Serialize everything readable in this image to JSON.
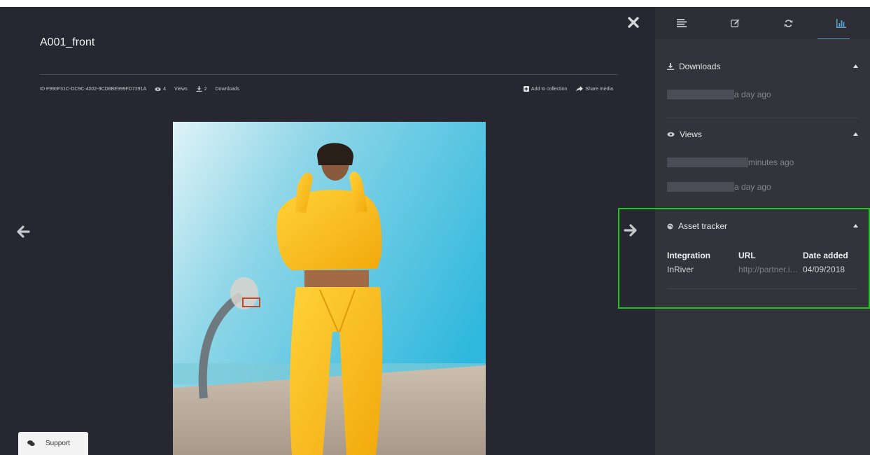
{
  "media": {
    "title": "A001_front",
    "id_text": "ID F990F31C-DC9C-4002-9CD8BE999FD7291A",
    "views_count": "4",
    "views_label": "Views",
    "downloads_count": "2",
    "downloads_label": "Downloads",
    "add_to_collection_label": "Add to collection",
    "share_media_label": "Share media"
  },
  "support": {
    "label": "Support"
  },
  "panel": {
    "tabs": [
      {
        "icon": "details-list-icon"
      },
      {
        "icon": "edit-icon"
      },
      {
        "icon": "refresh-icon"
      },
      {
        "icon": "bar-chart-icon",
        "active": true
      }
    ],
    "downloads": {
      "title": "Downloads",
      "entries": [
        {
          "time": "a day ago"
        }
      ]
    },
    "views": {
      "title": "Views",
      "entries": [
        {
          "time": "minutes ago"
        },
        {
          "time": "a day ago"
        }
      ]
    },
    "asset_tracker": {
      "title": "Asset tracker",
      "columns": [
        "Integration",
        "URL",
        "Date added"
      ],
      "rows": [
        {
          "integration": "InRiver",
          "url": "http://partner.inriver.com",
          "date": "04/09/2018"
        }
      ]
    }
  },
  "colors": {
    "viewer_bg": "#262730",
    "panel_bg": "#32333b",
    "highlight": "#22c41e",
    "accent": "#5aa8d2"
  }
}
